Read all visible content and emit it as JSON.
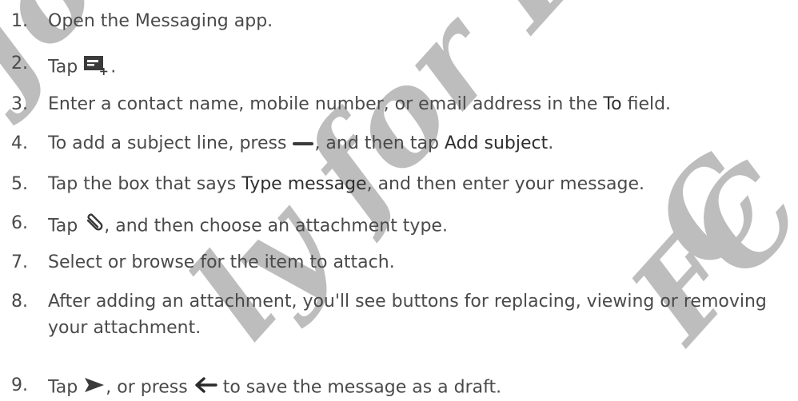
{
  "watermark": {
    "text_left": "Jo...ly for FCC",
    "text_right": "FCC",
    "color": "#b9b9b9"
  },
  "steps": [
    {
      "num": "1.",
      "parts": [
        "Open the Messaging app."
      ]
    },
    {
      "num": "2.",
      "parts": [
        "Tap ",
        "."
      ],
      "icon": "new-message-icon"
    },
    {
      "num": "3.",
      "parts": [
        "Enter a contact name, mobile number, or email address in the ",
        "To",
        " field."
      ]
    },
    {
      "num": "4.",
      "parts": [
        "To add a subject line, press ",
        ", and then tap ",
        "Add subject",
        "."
      ],
      "icon": "menu-dash-icon"
    },
    {
      "num": "5.",
      "parts": [
        "Tap the box that says ",
        "Type message",
        ", and then enter your message."
      ]
    },
    {
      "num": "6.",
      "parts": [
        "Tap ",
        ", and then choose an attachment type."
      ],
      "icon": "paperclip-icon"
    },
    {
      "num": "7.",
      "parts": [
        "Select or browse for the item to attach."
      ]
    },
    {
      "num": "8.",
      "parts": [
        "After adding an attachment, you'll see buttons for replacing, viewing or removing your attachment."
      ]
    },
    {
      "num": "9.",
      "parts": [
        "Tap ",
        ", or press ",
        " to save the message as a draft."
      ],
      "icons": [
        "send-icon",
        "back-arrow-icon"
      ]
    }
  ]
}
